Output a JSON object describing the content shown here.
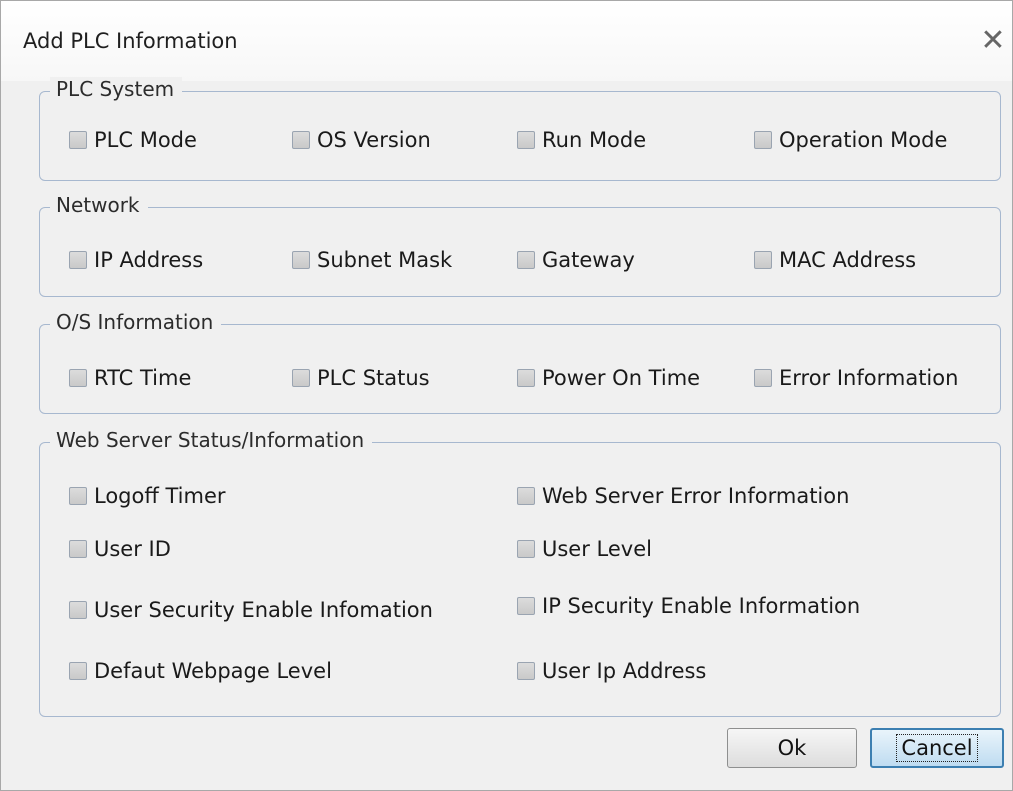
{
  "dialog": {
    "title": "Add PLC Information",
    "close_icon": "close-icon"
  },
  "groups": {
    "plc_system": {
      "legend": "PLC System",
      "items": [
        "PLC Mode",
        "OS Version",
        "Run Mode",
        "Operation Mode"
      ]
    },
    "network": {
      "legend": "Network",
      "items": [
        "IP Address",
        "Subnet Mask",
        "Gateway",
        "MAC Address"
      ]
    },
    "os_info": {
      "legend": "O/S Information",
      "items": [
        "RTC Time",
        "PLC Status",
        "Power On Time",
        "Error Information"
      ]
    },
    "web_server": {
      "legend": "Web Server Status/Information",
      "items": [
        "Logoff Timer",
        "Web Server Error Information",
        "User ID",
        "User Level",
        "User Security Enable Infomation",
        "IP Security Enable Information",
        "Defaut Webpage Level",
        "User Ip Address"
      ]
    }
  },
  "checked": false,
  "buttons": {
    "ok": "Ok",
    "cancel": "Cancel"
  },
  "colors": {
    "background": "#f0f0f0",
    "group_border": "#a7b8cf",
    "default_button": "#3c7fb1"
  }
}
